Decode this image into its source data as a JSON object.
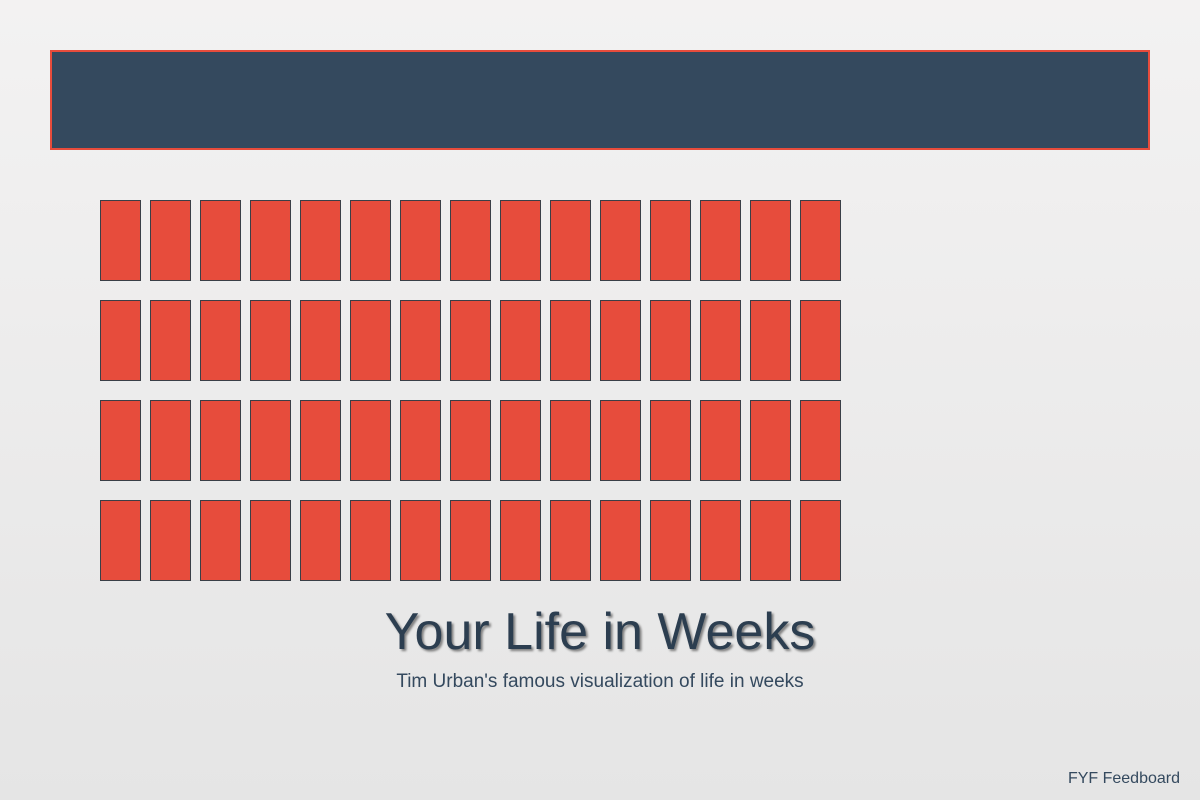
{
  "header": {
    "banner_color": "#34495e",
    "banner_border_color": "#e74c3c"
  },
  "grid": {
    "rows": 4,
    "columns": 15,
    "cell_color": "#e74c3c"
  },
  "title": "Your Life in Weeks",
  "subtitle": "Tim Urban's famous visualization of life in weeks",
  "footer": {
    "brand": "FYF Feedboard"
  }
}
